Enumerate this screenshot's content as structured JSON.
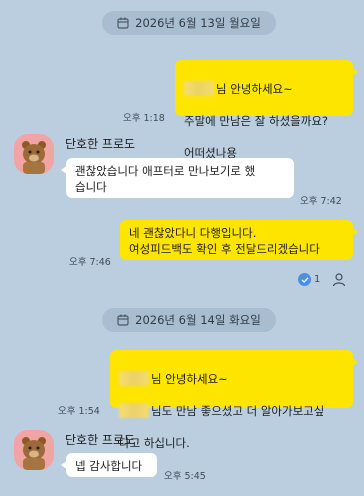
{
  "dates": [
    {
      "label": "2026년 6월 13일 월요일"
    },
    {
      "label": "2026년 6월 14일 화요일"
    }
  ],
  "sender": {
    "name": "단호한 프로도"
  },
  "messages": [
    {
      "line1_suffix": "님 안녕하세요~",
      "line2": "주말에 만남은 잘 하셨을까요?",
      "line3": "어떠셨나용",
      "time": "오후 1:18"
    },
    {
      "text": "괜찮았습니다 애프터로 만나보기로 했\n습니다",
      "time": "오후 7:42"
    },
    {
      "text": "네 괜찮았다니 다행입니다.\n여성피드백도 확인 후 전달드리겠습니다",
      "time": "오후 7:46",
      "read_count": "1"
    },
    {
      "line1_suffix": "님 안녕하세요~",
      "line2_suffix": "님도 만남 좋으셨고 더 알아가보고싶",
      "line3": "다고 하십니다.",
      "time": "오후 1:54"
    },
    {
      "text": "넵 감사합니다",
      "time": "오후 5:45"
    }
  ],
  "colors": {
    "background": "#bacee0",
    "my_bubble": "#fee500",
    "their_bubble": "#ffffff",
    "avatar_bg": "#f2a4a4"
  }
}
